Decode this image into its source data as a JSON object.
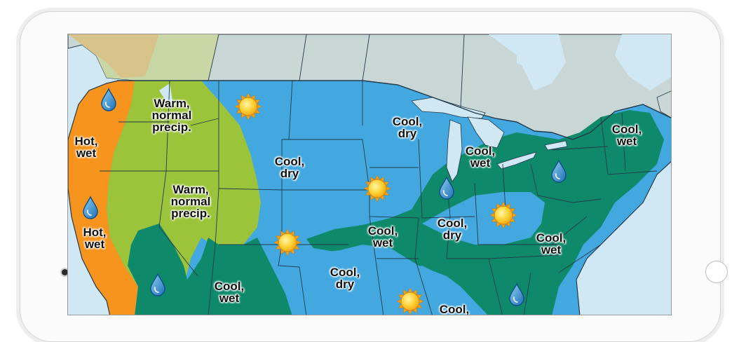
{
  "colors": {
    "ocean": "#cfe8f4",
    "canada_gray": "#c9d6d6",
    "hot_wet": "#f7941d",
    "warm_normal": "#9cc43b",
    "cool_dry": "#42a8df",
    "cool_wet": "#0e8a6a",
    "border": "#233a4a"
  },
  "icons": {
    "sun": "sun-icon",
    "rain": "raindrop-icon"
  },
  "regions": [
    {
      "name": "pacific-nw-hot-wet",
      "text": "Hot,\nwet"
    },
    {
      "name": "california-hot-wet",
      "text": "Hot,\nwet"
    },
    {
      "name": "northern-rockies-warm",
      "text": "Warm,\nnormal\nprecip."
    },
    {
      "name": "central-rockies-warm",
      "text": "Warm,\nnormal\nprecip."
    },
    {
      "name": "northern-plains-cool-dry",
      "text": "Cool,\ndry"
    },
    {
      "name": "upper-midwest-cool-dry",
      "text": "Cool,\ndry"
    },
    {
      "name": "great-lakes-cool-wet",
      "text": "Cool,\nwet"
    },
    {
      "name": "new-england-cool-wet",
      "text": "Cool,\nwet"
    },
    {
      "name": "central-plains-cool-wet",
      "text": "Cool,\nwet"
    },
    {
      "name": "ohio-valley-cool-dry",
      "text": "Cool,\ndry"
    },
    {
      "name": "mid-atlantic-cool-wet",
      "text": "Cool,\nwet"
    },
    {
      "name": "southern-plains-cool-dry",
      "text": "Cool,\ndry"
    },
    {
      "name": "southwest-cool-wet",
      "text": "Cool,\nwet"
    },
    {
      "name": "gulf-cool",
      "text": "Cool,"
    }
  ]
}
